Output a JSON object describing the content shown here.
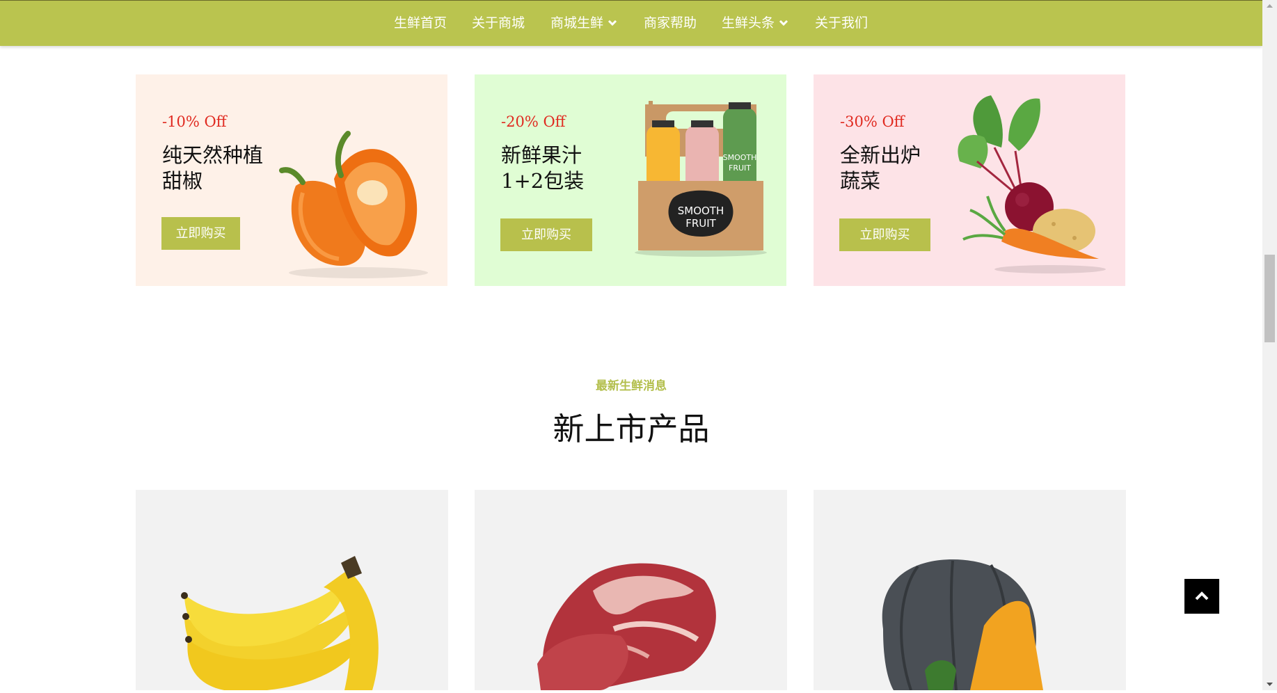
{
  "nav": {
    "items": [
      {
        "label": "生鲜首页",
        "dropdown": false
      },
      {
        "label": "关于商城",
        "dropdown": false
      },
      {
        "label": "商城生鲜",
        "dropdown": true
      },
      {
        "label": "商家帮助",
        "dropdown": false
      },
      {
        "label": "生鲜头条",
        "dropdown": true
      },
      {
        "label": "关于我们",
        "dropdown": false
      }
    ],
    "color": "#bac44f"
  },
  "banners": [
    {
      "discount": "-10% Off",
      "title_line1": "纯天然种植",
      "title_line2": "甜椒",
      "button": "立即购买",
      "bg": "#fef1e8",
      "image": "bell-pepper"
    },
    {
      "discount": "-20% Off",
      "title_line1": "新鲜果汁",
      "title_line2": "1+2包装",
      "button": "立即购买",
      "bg": "#e0fdd4",
      "image": "smooth-fruit-juice-box"
    },
    {
      "discount": "-30% Off",
      "title_line1": "全新出炉",
      "title_line2": "蔬菜",
      "button": "立即购买",
      "bg": "#fde3e7",
      "image": "beet-carrot-potato"
    }
  ],
  "section": {
    "subtitle": "最新生鲜消息",
    "heading": "新上市产品"
  },
  "products": [
    {
      "image": "banana"
    },
    {
      "image": "beef-steak"
    },
    {
      "image": "pumpkin"
    }
  ],
  "juice_box_text": {
    "label1": "SMOOTH",
    "label2": "FRUIT"
  },
  "colors": {
    "accent": "#b8c04c",
    "discount": "#e02a20"
  }
}
